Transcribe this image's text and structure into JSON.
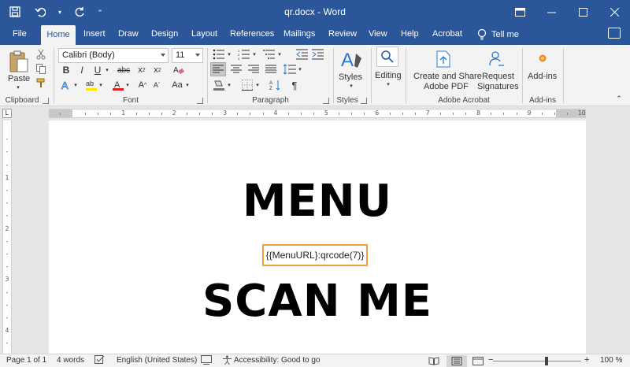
{
  "titlebar": {
    "title": "qr.docx  -  Word"
  },
  "tabs": [
    "File",
    "Home",
    "Insert",
    "Draw",
    "Design",
    "Layout",
    "References",
    "Mailings",
    "Review",
    "View",
    "Help",
    "Acrobat"
  ],
  "active_tab": "Home",
  "tell_me": "Tell me",
  "ribbon": {
    "clipboard": {
      "paste": "Paste",
      "label": "Clipboard"
    },
    "font": {
      "family": "Calibri (Body)",
      "size": "11",
      "label": "Font"
    },
    "paragraph": {
      "label": "Paragraph"
    },
    "styles": {
      "button": "Styles",
      "label": "Styles"
    },
    "editing": {
      "button": "Editing"
    },
    "acrobat": {
      "create_share_1": "Create and Share",
      "create_share_2": "Adobe PDF",
      "request_1": "Request",
      "request_2": "Signatures",
      "label": "Adobe Acrobat"
    },
    "addins": {
      "button": "Add-ins",
      "label": "Add-ins"
    }
  },
  "document": {
    "heading1": "MENU",
    "placeholder": "{{MenuURL}:qrcode(7)}",
    "heading2": "SCAN ME"
  },
  "statusbar": {
    "page": "Page 1 of 1",
    "words": "4 words",
    "language": "English (United States)",
    "accessibility": "Accessibility: Good to go",
    "zoom": "100 %"
  },
  "colors": {
    "word_blue": "#2b579a",
    "highlight": "#e8a33d"
  }
}
